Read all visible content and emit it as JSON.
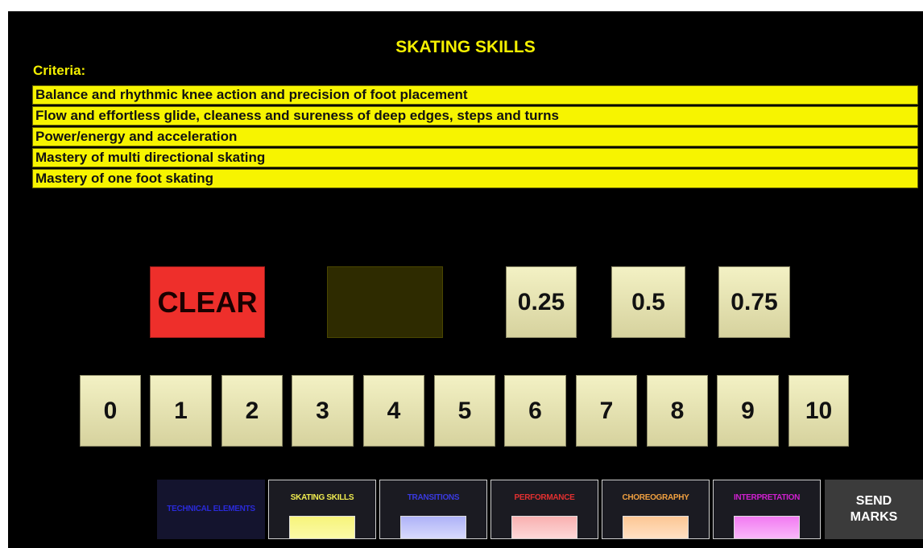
{
  "title": "SKATING SKILLS",
  "criteria_label": "Criteria:",
  "criteria": [
    "Balance and rhythmic knee action and precision of foot placement",
    "Flow and effortless glide, cleaness and sureness of deep edges, steps and turns",
    "Power/energy and acceleration",
    "Mastery of multi directional skating",
    "Mastery of one foot skating"
  ],
  "buttons": {
    "clear": "CLEAR",
    "blank": "",
    "fractions": [
      "0.25",
      "0.5",
      "0.75"
    ],
    "scores": [
      "0",
      "1",
      "2",
      "3",
      "4",
      "5",
      "6",
      "7",
      "8",
      "9",
      "10"
    ]
  },
  "tabs": [
    {
      "label": "TECHNICAL ELEMENTS",
      "color": "#2a2ad8",
      "swatch": null
    },
    {
      "label": "SKATING SKILLS",
      "color": "#f0ec50",
      "swatch": "#f7f47a"
    },
    {
      "label": "TRANSITIONS",
      "color": "#3a3ae0",
      "swatch": "#aeb2f8"
    },
    {
      "label": "PERFORMANCE",
      "color": "#e23030",
      "swatch": "#f9b0b0"
    },
    {
      "label": "CHOREOGRAPHY",
      "color": "#f0a040",
      "swatch": "#fdc794"
    },
    {
      "label": "INTERPRETATION",
      "color": "#d020d0",
      "swatch": "#f27af2"
    }
  ],
  "send": {
    "line1": "SEND",
    "line2": "MARKS"
  },
  "colors": {
    "accent": "#f5f000",
    "clear": "#ee2f2b",
    "background": "#000000"
  }
}
